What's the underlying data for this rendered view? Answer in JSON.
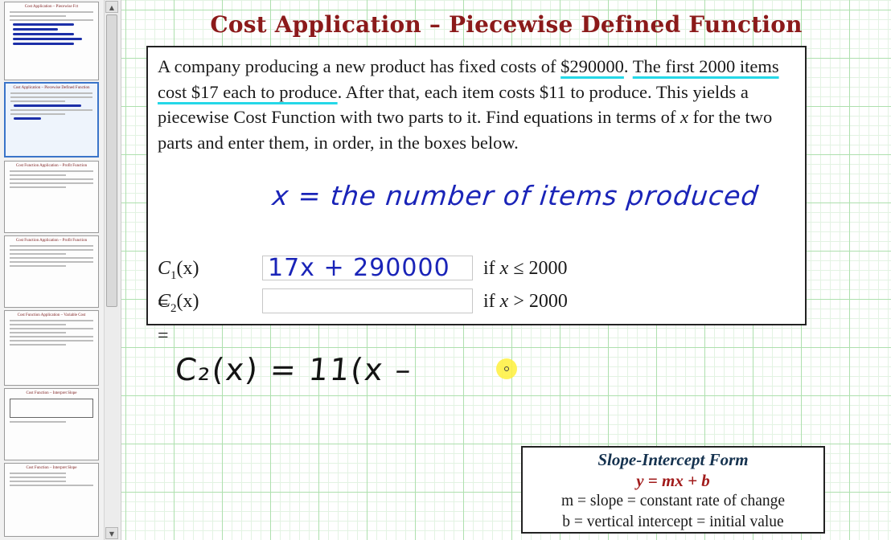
{
  "slide": {
    "title": "Cost Application – Piecewise Defined Function",
    "problem": {
      "p1": "A company producing a new product has fixed costs of ",
      "fixed_cost": "$290000",
      "p2": ". ",
      "first_items": "The first 2000 items cost $17 each to produce",
      "p3": ". After that, each item costs $11 to produce. This yields a piecewise Cost Function with two parts to it. Find equations in terms of ",
      "var": "x",
      "p4": " for the two parts and enter them, in order, in the boxes below."
    },
    "handwriting": {
      "x_definition": "x = the number of items produced",
      "work_line": "C₂(x) = 11(x –"
    },
    "answers": [
      {
        "label_prefix": "C",
        "label_sub": "1",
        "label_suffix": "(x) =",
        "value": "17x + 290000",
        "cond_if": "if ",
        "cond_var": "x",
        "cond_rest": " ≤ 2000"
      },
      {
        "label_prefix": "C",
        "label_sub": "2",
        "label_suffix": "(x) =",
        "value": "",
        "cond_if": "if ",
        "cond_var": "x",
        "cond_rest": " > 2000"
      }
    ],
    "slope_box": {
      "title": "Slope-Intercept Form",
      "equation": "y = mx + b",
      "m_line": "m = slope = constant rate of change",
      "b_line": "b = vertical intercept = initial value"
    }
  },
  "sidebar": {
    "thumbnails": [
      {
        "title": "Cost Application – Piecewise Fct"
      },
      {
        "title": "Cost Application – Piecewise Defined Function"
      },
      {
        "title": "Cost Function Application – Profit Function"
      },
      {
        "title": "Cost Function Application – Profit Function"
      },
      {
        "title": "Cost Function Application – Variable Cost"
      },
      {
        "title": "Cost Function – Interpret Slope"
      },
      {
        "title": "Cost Function – Interpret Slope"
      }
    ]
  },
  "colors": {
    "title": "#8b1a1a",
    "ink_blue": "#1a24b8",
    "highlight_underline": "#25d8e8",
    "grid": "#aee0ae",
    "slope_title": "#15324f",
    "slope_equation": "#a11b1b"
  },
  "icons": {
    "scroll_up": "scroll-up-arrow-icon",
    "scroll_down": "scroll-down-arrow-icon",
    "cursor": "pointer-highlight-icon"
  }
}
